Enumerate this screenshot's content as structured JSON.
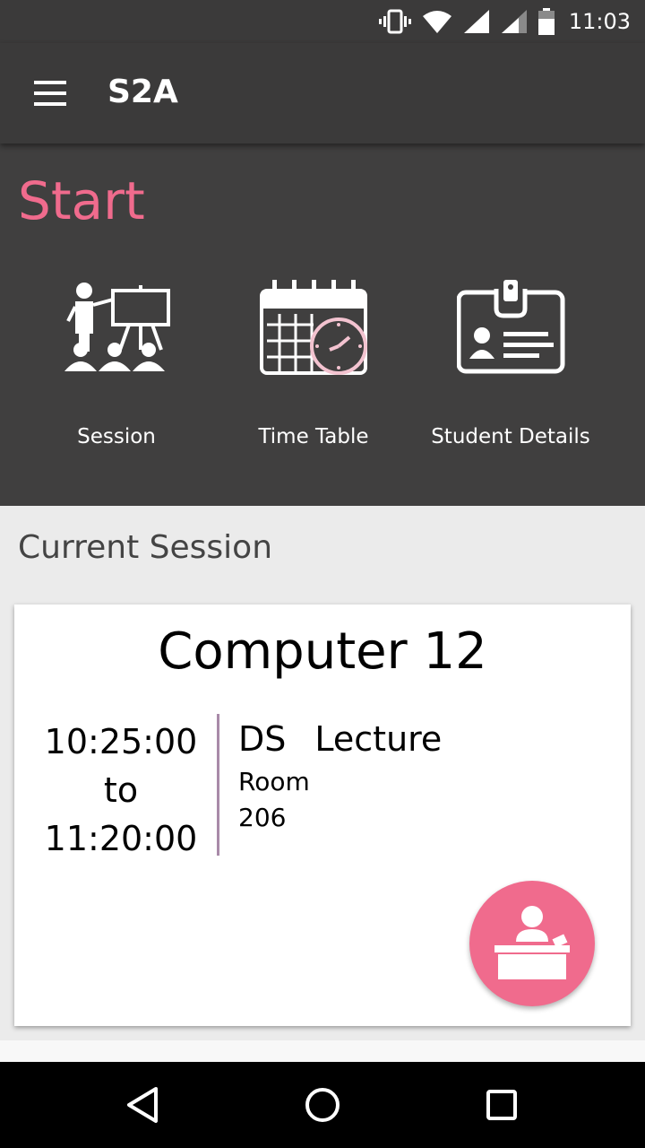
{
  "status_bar": {
    "time": "11:03",
    "icons": [
      "vibrate-icon",
      "wifi-icon",
      "signal-icon",
      "signal-icon",
      "battery-icon"
    ]
  },
  "app_bar": {
    "title": "S2A",
    "menu_icon": "hamburger-menu-icon"
  },
  "start": {
    "title": "Start",
    "accent_color": "#f06b8d",
    "tiles": [
      {
        "label": "Session",
        "icon": "presentation-icon"
      },
      {
        "label": "Time Table",
        "icon": "calendar-clock-icon"
      },
      {
        "label": "Student Details",
        "icon": "id-card-icon"
      }
    ]
  },
  "current_session": {
    "heading": "Current Session",
    "course": "Computer 12",
    "start_time": "10:25:00",
    "to_label": "to",
    "end_time": "11:20:00",
    "subject": "DS",
    "type": "Lecture",
    "room_label": "Room",
    "room_number": "206",
    "fab_icon": "teacher-desk-icon"
  },
  "nav_bar": {
    "icons": [
      "back-icon",
      "home-icon",
      "recents-icon"
    ]
  }
}
